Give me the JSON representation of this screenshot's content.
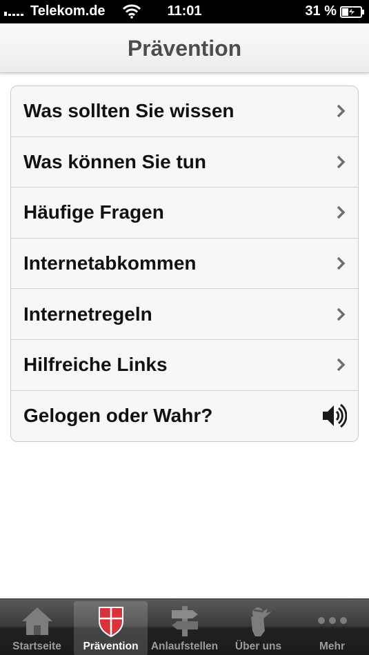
{
  "status_bar": {
    "carrier": "Telekom.de",
    "time": "11:01",
    "battery_percent": "31 %"
  },
  "nav": {
    "title": "Prävention"
  },
  "list": {
    "items": [
      {
        "label": "Was sollten Sie wissen",
        "accessory": "chevron-right-icon"
      },
      {
        "label": "Was können Sie tun",
        "accessory": "chevron-right-icon"
      },
      {
        "label": "Häufige Fragen",
        "accessory": "chevron-right-icon"
      },
      {
        "label": "Internetabkommen",
        "accessory": "chevron-right-icon"
      },
      {
        "label": "Internetregeln",
        "accessory": "chevron-right-icon"
      },
      {
        "label": "Hilfreiche Links",
        "accessory": "chevron-right-icon"
      },
      {
        "label": "Gelogen oder Wahr?",
        "accessory": "speaker-icon"
      }
    ]
  },
  "tab_bar": {
    "active_index": 1,
    "tabs": [
      {
        "label": "Startseite",
        "icon": "house-icon"
      },
      {
        "label": "Prävention",
        "icon": "shield-icon"
      },
      {
        "label": "Anlaufstellen",
        "icon": "signpost-icon"
      },
      {
        "label": "Über uns",
        "icon": "mascot-icon"
      },
      {
        "label": "Mehr",
        "icon": "more-dots-icon"
      }
    ]
  },
  "colors": {
    "status_bar_bg": "#000000",
    "nav_title": "#4d4d4d",
    "shield_red": "#d8333a",
    "tab_bar_bg": "#2b2b2b"
  }
}
